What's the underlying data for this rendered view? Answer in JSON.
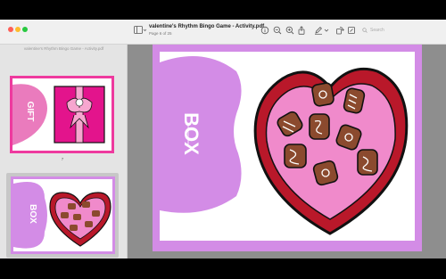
{
  "window": {
    "title": "valentine's Rhythm Bingo Game - Activity.pdf",
    "subtitle": "Page 6 of 25"
  },
  "toolbar": {
    "search_placeholder": "Search",
    "icons": [
      "sidebar-toggle-icon",
      "info-icon",
      "zoom-out-icon",
      "zoom-in-icon",
      "share-icon",
      "markup-icon",
      "rotate-icon",
      "annotate-icon"
    ]
  },
  "sidebar": {
    "header": "valentine's Rhythm Bingo Game - Activity.pdf",
    "pages": [
      {
        "number": "7",
        "label": "GIFT",
        "selected": false
      },
      {
        "number": "8",
        "label": "BOX",
        "selected": true
      }
    ]
  },
  "document": {
    "page_label": "BOX",
    "colors": {
      "purple": "#d38ce6",
      "pink": "#ea7bbd",
      "magenta": "#ee3a9e",
      "heart_red": "#b9182a",
      "chocolate": "#8b4a2e"
    }
  }
}
